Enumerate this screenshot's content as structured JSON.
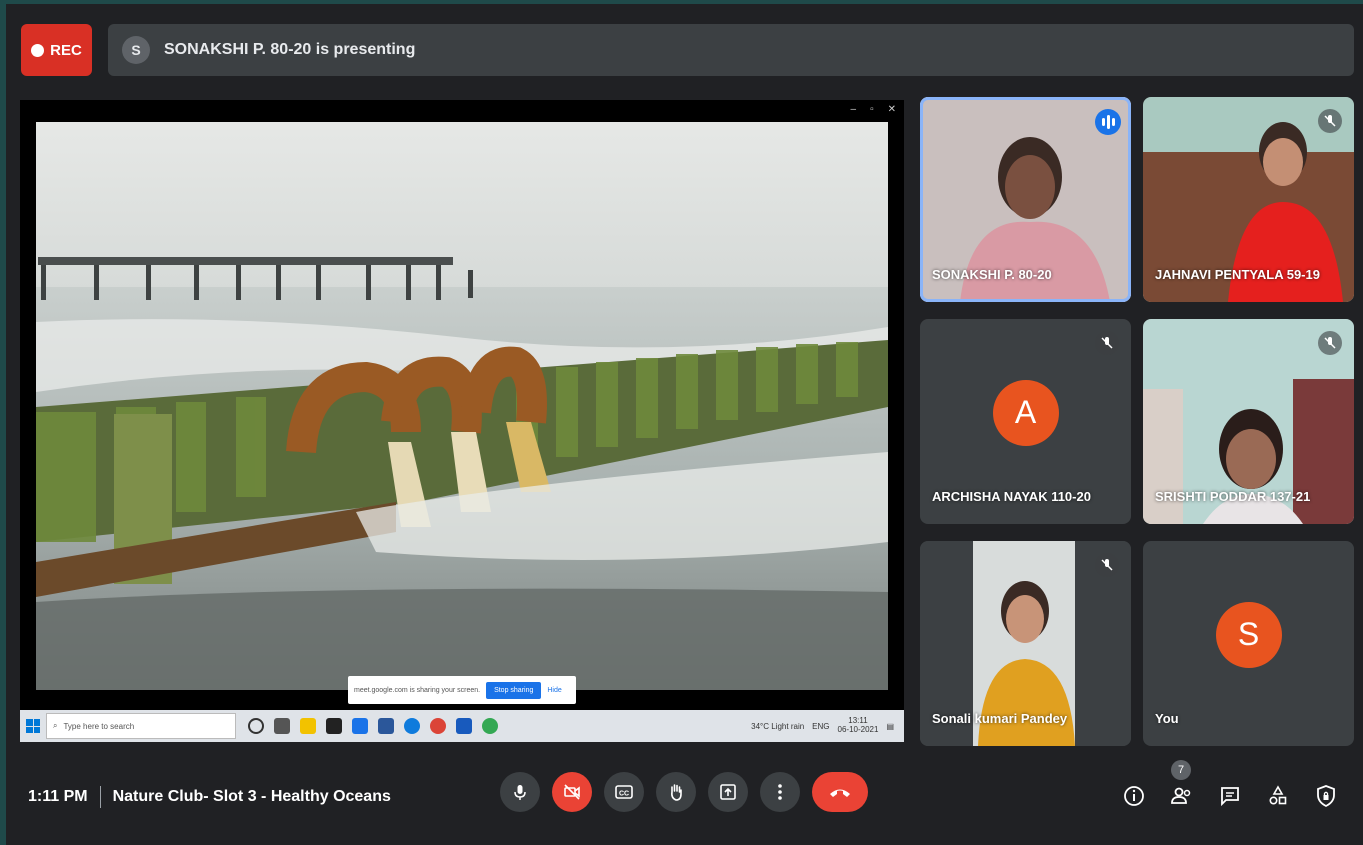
{
  "top": {
    "rec_label": "REC",
    "presenter_initial": "S",
    "presenting_text": "SONAKSHI P. 80-20 is presenting"
  },
  "presentation": {
    "share_notice": "meet.google.com is sharing your screen.",
    "stop_sharing_label": "Stop sharing",
    "hide_label": "Hide",
    "taskbar_search_placeholder": "Type here to search",
    "tray_weather": "34°C  Light rain",
    "tray_lang": "ENG",
    "tray_time": "13:11",
    "tray_date": "06-10-2021"
  },
  "participants": [
    {
      "name": "SONAKSHI P. 80-20",
      "speaking": true
    },
    {
      "name": "JAHNAVI PENTYALA 59-19",
      "muted": true
    },
    {
      "name": "ARCHISHA NAYAK 110-20",
      "initial": "A",
      "muted": true
    },
    {
      "name": "SRISHTI PODDAR 137-21",
      "muted": true
    },
    {
      "name": "Sonali kumari Pandey",
      "muted": true
    },
    {
      "name": "You",
      "initial": "S"
    }
  ],
  "bottom": {
    "time": "1:11 PM",
    "meeting_title": "Nature Club- Slot 3 - Healthy Oceans",
    "participant_count": "7"
  },
  "colors": {
    "background": "#202124",
    "rec": "#d93025",
    "end_call": "#ea4335",
    "speaking_outline": "#8ab4f8",
    "avatar": "#e8541f"
  }
}
